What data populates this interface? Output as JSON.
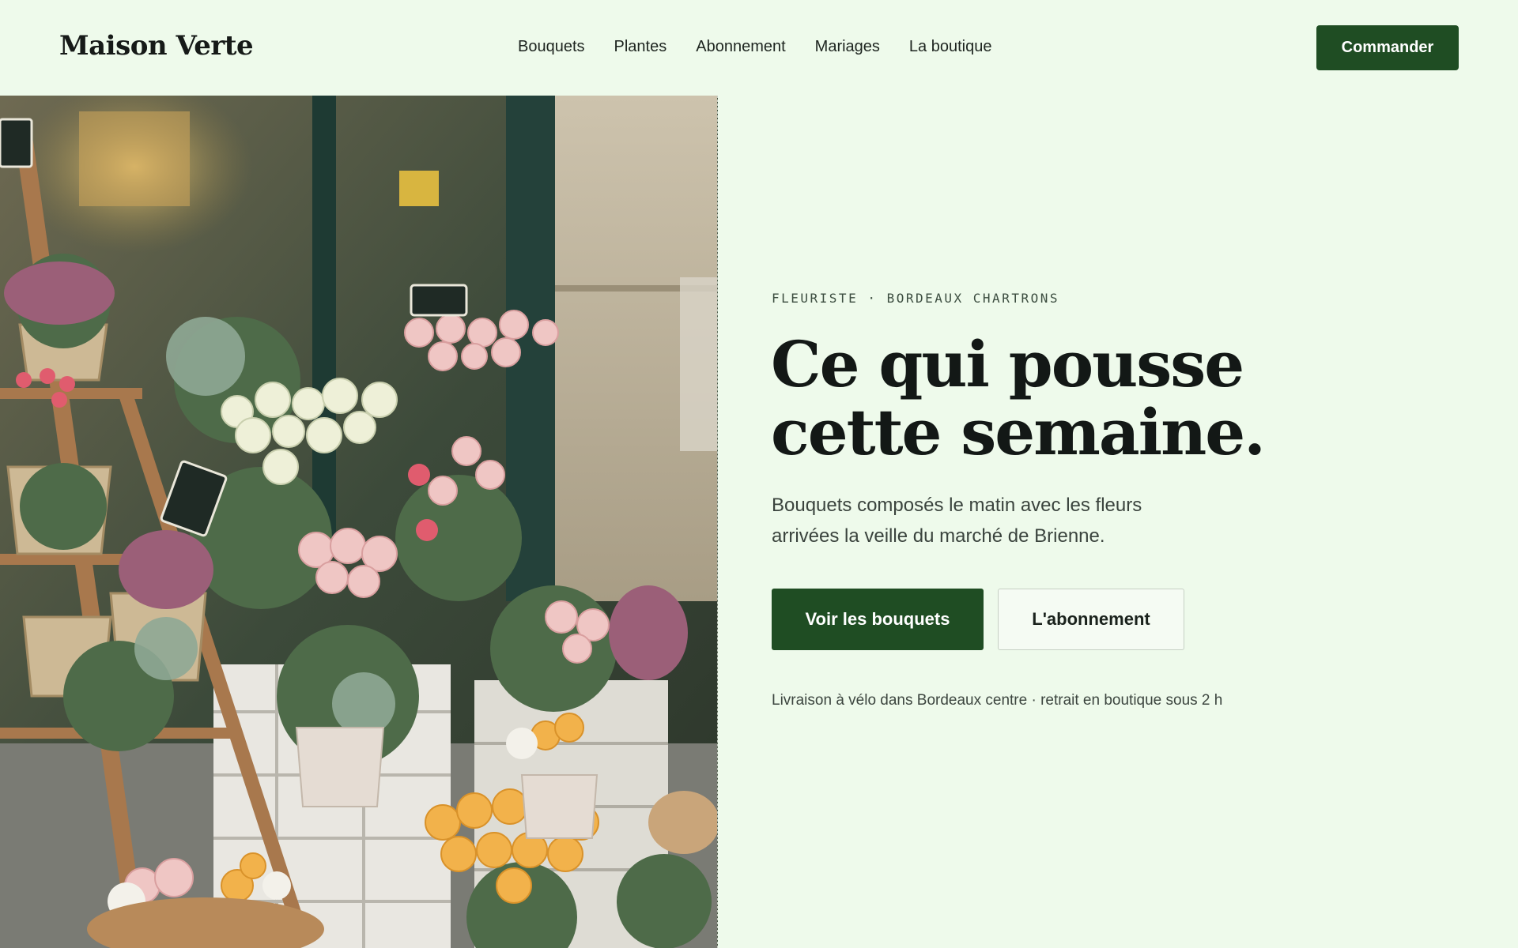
{
  "brand": {
    "name": "Maison Verte"
  },
  "nav": {
    "items": [
      {
        "label": "Bouquets"
      },
      {
        "label": "Plantes"
      },
      {
        "label": "Abonnement"
      },
      {
        "label": "Mariages"
      },
      {
        "label": "La boutique"
      }
    ],
    "cta_label": "Commander"
  },
  "hero": {
    "eyebrow": "FLEURISTE · BORDEAUX CHARTRONS",
    "headline": "Ce qui pousse cette semaine.",
    "lede": "Bouquets composés le matin avec les fleurs arrivées la veille du marché de Brienne.",
    "primary_button": "Voir les bouquets",
    "secondary_button": "L'abonnement",
    "note": "Livraison à vélo dans Bordeaux centre · retrait en boutique sous 2 h"
  },
  "colors": {
    "background": "#eefaeb",
    "accent": "#1f4d23",
    "text": "#131816"
  }
}
